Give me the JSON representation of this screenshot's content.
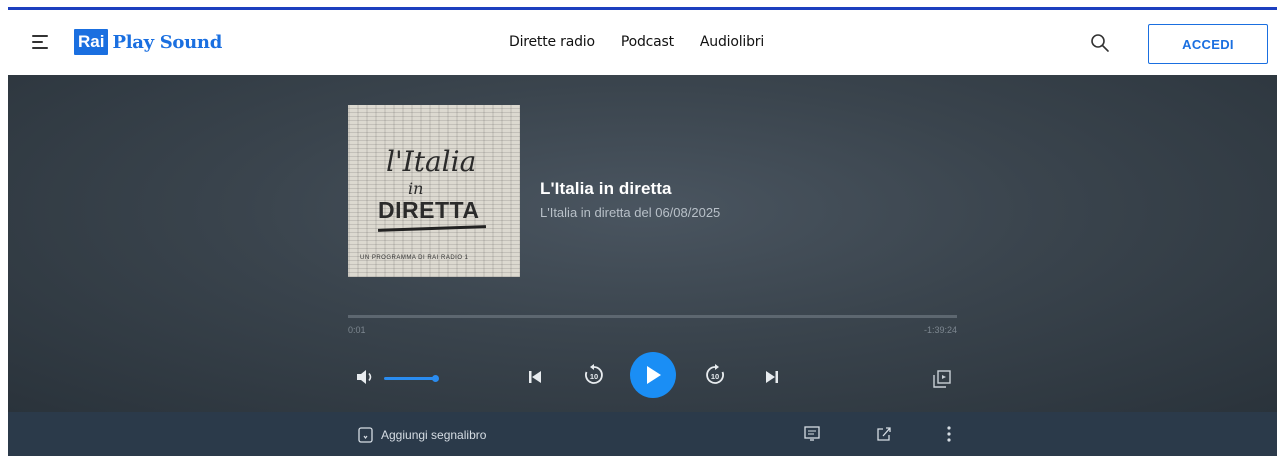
{
  "header": {
    "logo_rai": "Rai",
    "logo_playsound": "Play Sound",
    "nav": [
      {
        "label": "Dirette radio"
      },
      {
        "label": "Podcast"
      },
      {
        "label": "Audiolibri"
      }
    ],
    "login_label": "ACCEDI"
  },
  "player": {
    "cover": {
      "line1": "l'Italia",
      "line2": "in",
      "line3": "DIRETTA",
      "footer": "UN PROGRAMMA DI RAI RADIO 1"
    },
    "title": "L'Italia in diretta",
    "subtitle": "L'Italia in diretta del 06/08/2025",
    "time_elapsed": "0:01",
    "time_remaining": "-1:39:24",
    "progress_fraction": 0.0002,
    "volume_fraction": 1.0,
    "skip_seconds": "10"
  },
  "bottom": {
    "bookmark_label": "Aggiungi segnalibro"
  },
  "colors": {
    "accent": "#1a6fe0",
    "play": "#1a8ef5",
    "bottom_bar": "#2b3a4a"
  },
  "icons": [
    "menu-icon",
    "search-icon",
    "volume-icon",
    "previous-icon",
    "rewind-10-icon",
    "play-icon",
    "forward-10-icon",
    "next-icon",
    "queue-icon",
    "bookmark-icon",
    "transcript-icon",
    "share-icon",
    "more-icon"
  ]
}
